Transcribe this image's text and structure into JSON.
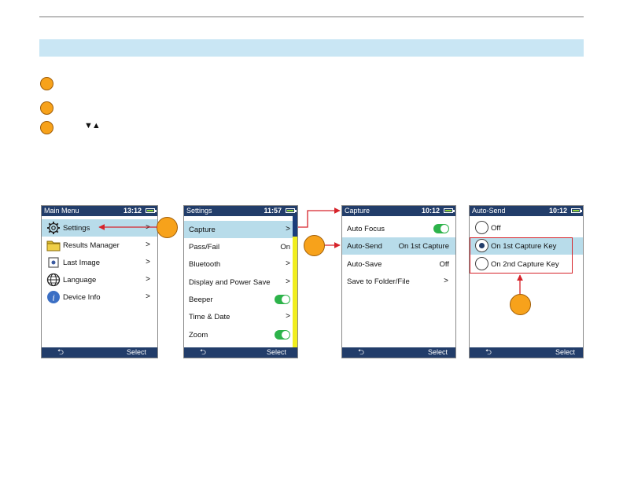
{
  "colors": {
    "title_bar": "#223d6a",
    "highlight": "#b8dcea",
    "callout": "#f7a21b",
    "toggle_on": "#2db34a",
    "arrow": "#d6232a",
    "band": "#c9e6f4"
  },
  "icons": {
    "nav_arrows": "▼▲",
    "back": "back-arrow-icon",
    "chevron": "›"
  },
  "main_menu": {
    "title": "Main Menu",
    "time": "13:12",
    "items": [
      {
        "label": "Settings",
        "icon": "gear-icon"
      },
      {
        "label": "Results Manager",
        "icon": "folder-icon"
      },
      {
        "label": "Last Image",
        "icon": "image-icon"
      },
      {
        "label": "Language",
        "icon": "globe-icon"
      },
      {
        "label": "Device Info",
        "icon": "info-icon"
      }
    ],
    "chevrons": [
      ">",
      ">",
      ">",
      ">",
      ">"
    ],
    "softkeys": {
      "back": "⮌",
      "select": "Select"
    }
  },
  "settings": {
    "title": "Settings",
    "time": "11:57",
    "items": [
      {
        "label": "Capture",
        "value": ">"
      },
      {
        "label": "Pass/Fail",
        "value": "On"
      },
      {
        "label": "Bluetooth",
        "value": ">"
      },
      {
        "label": "Display and Power Save",
        "value": ">"
      },
      {
        "label": "Beeper",
        "value": ""
      },
      {
        "label": "Time & Date",
        "value": ">"
      },
      {
        "label": "Zoom",
        "value": ""
      }
    ],
    "softkeys": {
      "back": "⮌",
      "select": "Select"
    }
  },
  "capture": {
    "title": "Capture",
    "time": "10:12",
    "items": [
      {
        "label": "Auto Focus",
        "value": ""
      },
      {
        "label": "Auto-Send",
        "value": "On 1st Capture"
      },
      {
        "label": "Auto-Save",
        "value": "Off"
      },
      {
        "label": "Save to Folder/File",
        "value": ">"
      }
    ],
    "softkeys": {
      "back": "⮌",
      "select": "Select"
    }
  },
  "auto_send": {
    "title": "Auto-Send",
    "time": "10:12",
    "options": [
      {
        "label": "Off",
        "selected": false
      },
      {
        "label": "On 1st Capture Key",
        "selected": true
      },
      {
        "label": "On 2nd Capture Key",
        "selected": false
      }
    ],
    "softkeys": {
      "back": "⮌",
      "select": "Select"
    }
  }
}
